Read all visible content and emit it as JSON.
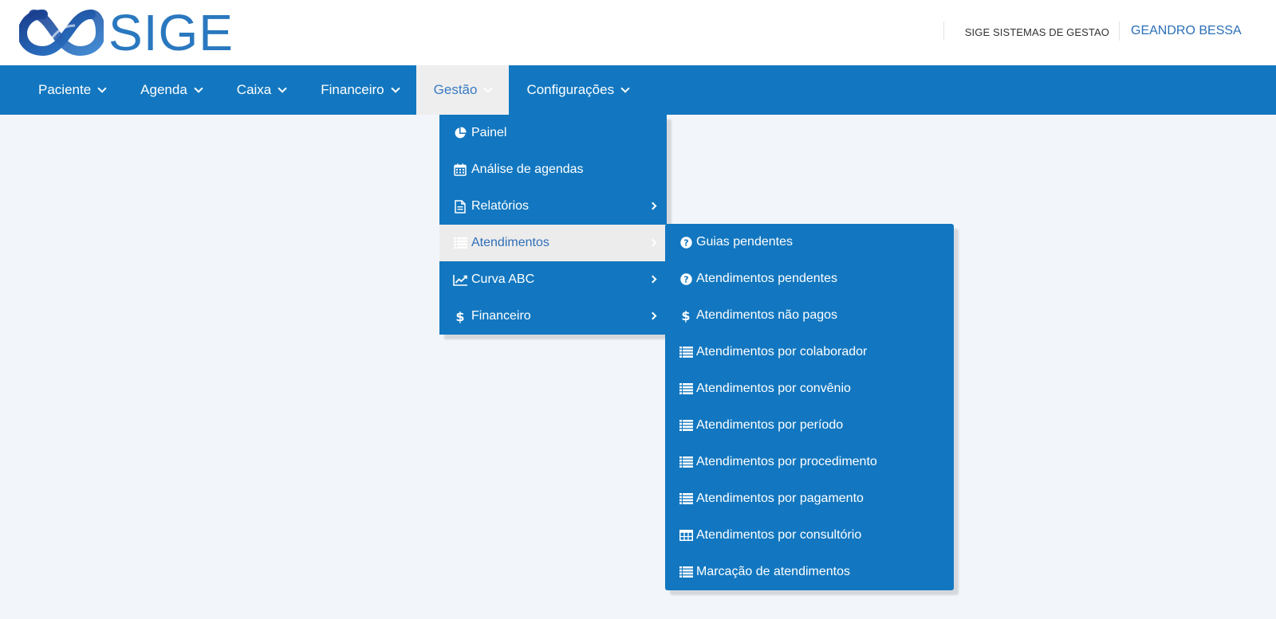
{
  "brand": {
    "logo_text": "SIGE",
    "company": "SIGE SISTEMAS DE GESTAO",
    "user": "GEANDRO BESSA"
  },
  "navbar": {
    "items": [
      {
        "label": "Paciente"
      },
      {
        "label": "Agenda"
      },
      {
        "label": "Caixa"
      },
      {
        "label": "Financeiro"
      },
      {
        "label": "Gestão"
      },
      {
        "label": "Configurações"
      }
    ]
  },
  "gestao_menu": {
    "items": [
      {
        "label": "Painel",
        "icon": "pie-chart-icon"
      },
      {
        "label": "Análise de agendas",
        "icon": "calendar-icon"
      },
      {
        "label": "Relatórios",
        "icon": "file-icon"
      },
      {
        "label": "Atendimentos",
        "icon": "list-icon"
      },
      {
        "label": "Curva ABC",
        "icon": "line-chart-icon"
      },
      {
        "label": "Financeiro",
        "icon": "dollar-icon"
      }
    ]
  },
  "atendimentos_submenu": {
    "items": [
      {
        "label": "Guias pendentes",
        "icon": "question-circle-icon"
      },
      {
        "label": "Atendimentos pendentes",
        "icon": "question-circle-icon"
      },
      {
        "label": "Atendimentos não pagos",
        "icon": "dollar-icon"
      },
      {
        "label": "Atendimentos por colaborador",
        "icon": "list-icon"
      },
      {
        "label": "Atendimentos por convênio",
        "icon": "list-icon"
      },
      {
        "label": "Atendimentos por período",
        "icon": "list-icon"
      },
      {
        "label": "Atendimentos por procedimento",
        "icon": "list-icon"
      },
      {
        "label": "Atendimentos por pagamento",
        "icon": "list-icon"
      },
      {
        "label": "Atendimentos por consultório",
        "icon": "table-icon"
      },
      {
        "label": "Marcação de atendimentos",
        "icon": "list-icon"
      }
    ]
  },
  "colors": {
    "primary": "#1277c0",
    "active_bg": "#eeeeee",
    "page_bg": "#f2f5fa",
    "logo_blue": "#2a78bf"
  }
}
